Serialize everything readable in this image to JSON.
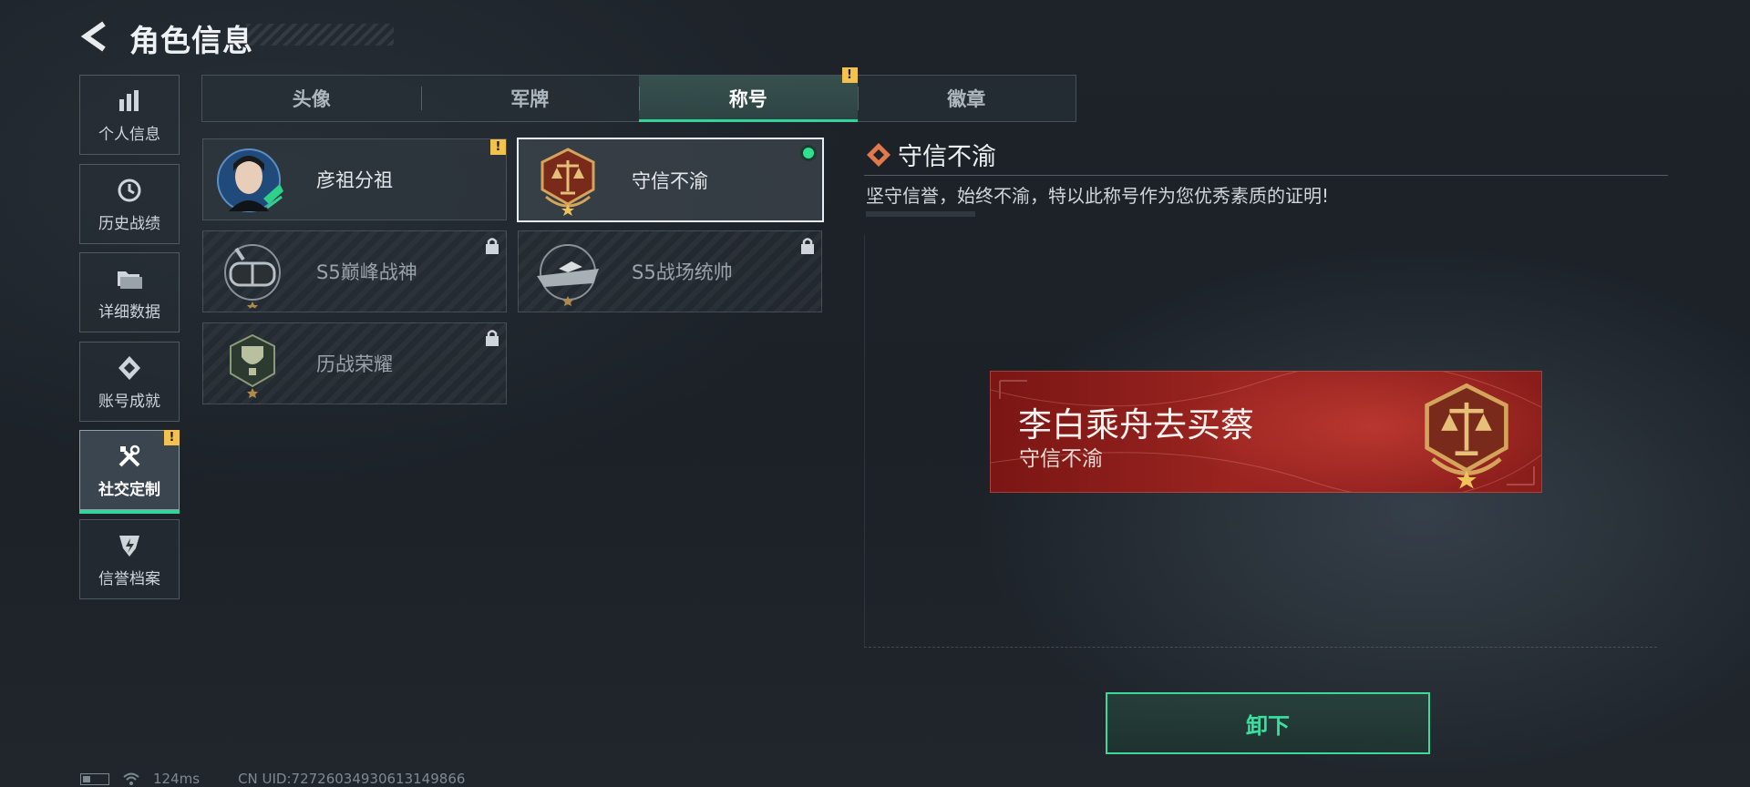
{
  "header": {
    "title": "角色信息",
    "back_icon": "back-arrow-icon"
  },
  "sidebar": {
    "items": [
      {
        "label": "个人信息",
        "icon": "bar-chart-icon",
        "active": false
      },
      {
        "label": "历史战绩",
        "icon": "history-clock-icon",
        "active": false
      },
      {
        "label": "详细数据",
        "icon": "folder-icon",
        "active": false
      },
      {
        "label": "账号成就",
        "icon": "achievement-icon",
        "active": false
      },
      {
        "label": "社交定制",
        "icon": "tools-icon",
        "active": true,
        "badge": "!"
      },
      {
        "label": "信誉档案",
        "icon": "shield-lightning-icon",
        "active": false
      }
    ]
  },
  "tabs": [
    {
      "label": "头像",
      "active": false
    },
    {
      "label": "军牌",
      "active": false
    },
    {
      "label": "称号",
      "active": true,
      "badge": "!"
    },
    {
      "label": "徽章",
      "active": false
    }
  ],
  "titles": [
    {
      "name": "彦祖分祖",
      "icon": "portrait-avatar-icon",
      "locked": false,
      "badge": "!"
    },
    {
      "name": "守信不渝",
      "icon": "scales-emblem-icon",
      "locked": false,
      "selected": true,
      "equipped": true
    },
    {
      "name": "S5巅峰战神",
      "icon": "diving-mask-icon",
      "locked": true
    },
    {
      "name": "S5战场统帅",
      "icon": "warship-icon",
      "locked": true
    },
    {
      "name": "历战荣耀",
      "icon": "trophy-icon",
      "locked": true
    }
  ],
  "detail": {
    "title": "守信不渝",
    "description": "坚守信誉，始终不渝，特以此称号作为您优秀素质的证明!"
  },
  "preview": {
    "player_name": "李白乘舟去买蔡",
    "title": "守信不渝"
  },
  "actions": {
    "unequip_label": "卸下"
  },
  "status_bar": {
    "ping": "124ms",
    "uid": "CN UID:72726034930613149866"
  },
  "colors": {
    "accent": "#34d39a",
    "warning": "#f2c14e",
    "banner_red": "#9a2420"
  }
}
